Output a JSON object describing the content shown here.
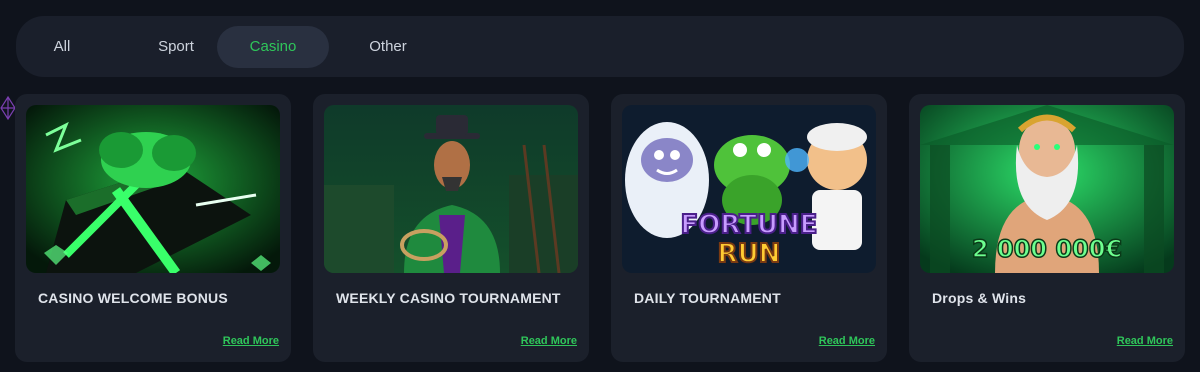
{
  "tabs": [
    {
      "label": "All",
      "active": false
    },
    {
      "label": "Sport",
      "active": false
    },
    {
      "label": "Casino",
      "active": true
    },
    {
      "label": "Other",
      "active": false
    }
  ],
  "cards": [
    {
      "title": "CASINO WELCOME BONUS",
      "link": "Read More",
      "image": "green-gift-box"
    },
    {
      "title": "WEEKLY CASINO TOURNAMENT",
      "link": "Read More",
      "image": "cowboy-character"
    },
    {
      "title": "DAILY TOURNAMENT",
      "link": "Read More",
      "image": "fortune-run-characters",
      "image_text": [
        "FORTUNE",
        "RUN"
      ]
    },
    {
      "title": "Drops & Wins",
      "link": "Read More",
      "image": "zeus-character",
      "image_text": [
        "2 000 000€"
      ]
    }
  ],
  "colors": {
    "background": "#0f131c",
    "card": "#1b202b",
    "tab_bar": "#1a1f2b",
    "tab_active_bg": "#293040",
    "accent_green": "#2fc65a",
    "title_text": "#dfe3ea"
  }
}
